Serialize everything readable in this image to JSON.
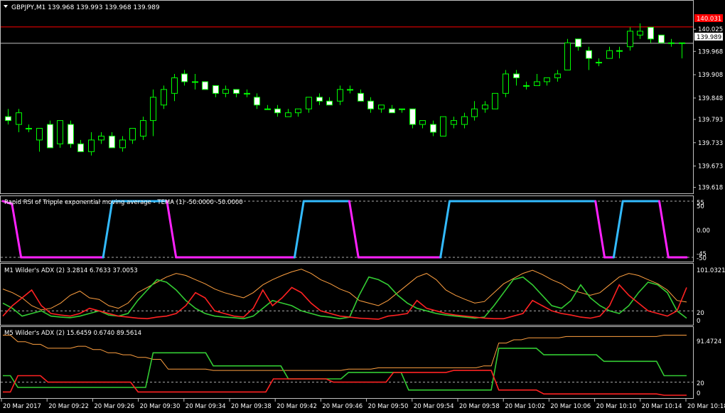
{
  "colors": {
    "background": "#000000",
    "bull_candle": "#00ff00",
    "bear_candle": "#ffffff",
    "tema_up": "#33bbff",
    "tema_down": "#ff22ff",
    "adx_main": "#ffa040",
    "adx_plus": "#33cc33",
    "adx_minus": "#ff2222",
    "price_line_red": "#ff0000",
    "bid_line": "#c0c0c0"
  },
  "main": {
    "symbol_caption": "GBPJPY,M1  139.968 139.993 139.968 139.989",
    "menu_icon": "triangle-down-icon",
    "price_ticks": [
      "140.025",
      "139.968",
      "139.908",
      "139.848",
      "139.793",
      "139.733",
      "139.673",
      "139.618"
    ],
    "red_line_label": "140.031",
    "bid_label": "139.989",
    "ylim": [
      139.61,
      140.06
    ],
    "candles": [
      [
        139.8,
        139.82,
        139.78,
        139.79
      ],
      [
        139.78,
        139.82,
        139.76,
        139.81
      ],
      [
        139.77,
        139.78,
        139.76,
        139.77
      ],
      [
        139.74,
        139.77,
        139.71,
        139.77
      ],
      [
        139.78,
        139.79,
        139.72,
        139.72
      ],
      [
        139.73,
        139.79,
        139.72,
        139.79
      ],
      [
        139.78,
        139.79,
        139.72,
        139.73
      ],
      [
        139.73,
        139.74,
        139.71,
        139.71
      ],
      [
        139.71,
        139.76,
        139.7,
        139.74
      ],
      [
        139.74,
        139.76,
        139.73,
        139.75
      ],
      [
        139.75,
        139.76,
        139.72,
        139.72
      ],
      [
        139.72,
        139.75,
        139.71,
        139.74
      ],
      [
        139.74,
        139.77,
        139.73,
        139.77
      ],
      [
        139.75,
        139.8,
        139.74,
        139.79
      ],
      [
        139.79,
        139.87,
        139.75,
        139.85
      ],
      [
        139.83,
        139.88,
        139.82,
        139.87
      ],
      [
        139.86,
        139.91,
        139.84,
        139.9
      ],
      [
        139.91,
        139.92,
        139.88,
        139.89
      ],
      [
        139.89,
        139.91,
        139.87,
        139.89
      ],
      [
        139.89,
        139.89,
        139.87,
        139.87
      ],
      [
        139.88,
        139.88,
        139.85,
        139.86
      ],
      [
        139.86,
        139.88,
        139.85,
        139.87
      ],
      [
        139.87,
        139.87,
        139.85,
        139.86
      ],
      [
        139.86,
        139.87,
        139.85,
        139.86
      ],
      [
        139.85,
        139.86,
        139.82,
        139.83
      ],
      [
        139.82,
        139.83,
        139.82,
        139.82
      ],
      [
        139.82,
        139.83,
        139.8,
        139.81
      ],
      [
        139.8,
        139.82,
        139.8,
        139.81
      ],
      [
        139.81,
        139.82,
        139.8,
        139.82
      ],
      [
        139.82,
        139.85,
        139.81,
        139.85
      ],
      [
        139.85,
        139.86,
        139.83,
        139.84
      ],
      [
        139.84,
        139.85,
        139.83,
        139.83
      ],
      [
        139.84,
        139.88,
        139.83,
        139.87
      ],
      [
        139.87,
        139.88,
        139.86,
        139.87
      ],
      [
        139.86,
        139.87,
        139.84,
        139.84
      ],
      [
        139.84,
        139.85,
        139.81,
        139.82
      ],
      [
        139.82,
        139.83,
        139.81,
        139.83
      ],
      [
        139.82,
        139.83,
        139.81,
        139.81
      ],
      [
        139.82,
        139.82,
        139.81,
        139.82
      ],
      [
        139.82,
        139.82,
        139.77,
        139.78
      ],
      [
        139.78,
        139.79,
        139.77,
        139.79
      ],
      [
        139.78,
        139.79,
        139.75,
        139.76
      ],
      [
        139.75,
        139.8,
        139.75,
        139.8
      ],
      [
        139.78,
        139.8,
        139.77,
        139.79
      ],
      [
        139.78,
        139.81,
        139.77,
        139.8
      ],
      [
        139.8,
        139.84,
        139.79,
        139.82
      ],
      [
        139.82,
        139.84,
        139.81,
        139.83
      ],
      [
        139.82,
        139.86,
        139.82,
        139.86
      ],
      [
        139.86,
        139.92,
        139.85,
        139.91
      ],
      [
        139.91,
        139.92,
        139.88,
        139.9
      ],
      [
        139.88,
        139.89,
        139.87,
        139.88
      ],
      [
        139.88,
        139.91,
        139.88,
        139.89
      ],
      [
        139.89,
        139.9,
        139.88,
        139.9
      ],
      [
        139.9,
        139.92,
        139.89,
        139.91
      ],
      [
        139.92,
        140.0,
        139.92,
        139.99
      ],
      [
        140.0,
        140.0,
        139.97,
        139.98
      ],
      [
        139.97,
        139.98,
        139.92,
        139.95
      ],
      [
        139.94,
        139.95,
        139.93,
        139.94
      ],
      [
        139.95,
        139.98,
        139.95,
        139.97
      ],
      [
        139.97,
        139.98,
        139.95,
        139.97
      ],
      [
        139.98,
        140.03,
        139.97,
        140.02
      ],
      [
        140.01,
        140.04,
        140.0,
        140.02
      ],
      [
        140.03,
        140.03,
        139.99,
        140.0
      ],
      [
        140.01,
        140.01,
        139.99,
        139.99
      ],
      [
        139.99,
        140.0,
        139.98,
        139.99
      ],
      [
        139.99,
        139.99,
        139.95,
        139.99
      ]
    ]
  },
  "tema": {
    "caption": "Rapid RSI of Tripple exponential moving average - TEMA (1) -50.0000 -50.0000",
    "ticks": [
      "55",
      "50",
      "0.00",
      "-45",
      "-50"
    ],
    "ylim": [
      -55,
      55
    ],
    "levels": [
      50,
      -50
    ],
    "values": [
      50,
      45,
      -50,
      -50,
      -50,
      -50,
      -50,
      -50,
      -50,
      -50,
      -50,
      -50,
      50,
      50,
      50,
      50,
      50,
      50,
      50,
      -50,
      -50,
      -50,
      -50,
      -50,
      -50,
      -50,
      -50,
      -50,
      -50,
      -50,
      -50,
      -50,
      -50,
      50,
      50,
      50,
      50,
      50,
      50,
      -50,
      -50,
      -50,
      -50,
      -50,
      -50,
      -50,
      -50,
      -50,
      -50,
      50,
      50,
      50,
      50,
      50,
      50,
      50,
      50,
      50,
      50,
      50,
      50,
      50,
      50,
      50,
      50,
      50,
      -50,
      -50,
      50,
      50,
      50,
      50,
      50,
      -50,
      -50,
      -50
    ]
  },
  "adx1": {
    "caption": "M1 Wilder's  ADX (2) 3.2814 6.7633 37.0053",
    "ticks": [
      "101.0321",
      "20",
      "0"
    ],
    "ylim": [
      0,
      101
    ],
    "level": 20,
    "adx": [
      62,
      55,
      45,
      30,
      22,
      25,
      35,
      50,
      58,
      45,
      42,
      30,
      25,
      35,
      55,
      65,
      75,
      85,
      92,
      88,
      80,
      72,
      62,
      55,
      50,
      45,
      55,
      70,
      80,
      88,
      95,
      100,
      92,
      80,
      72,
      62,
      55,
      40,
      35,
      30,
      40,
      55,
      70,
      85,
      92,
      80,
      60,
      50,
      42,
      35,
      38,
      55,
      72,
      82,
      92,
      98,
      90,
      80,
      72,
      60,
      55,
      50,
      55,
      70,
      85,
      92,
      88,
      80,
      72,
      60,
      40,
      37
    ],
    "plus_di": [
      35,
      25,
      10,
      15,
      20,
      10,
      8,
      7,
      10,
      15,
      20,
      12,
      10,
      15,
      40,
      60,
      80,
      75,
      60,
      40,
      25,
      15,
      10,
      8,
      7,
      5,
      10,
      25,
      40,
      35,
      30,
      20,
      15,
      10,
      8,
      5,
      8,
      50,
      85,
      80,
      70,
      50,
      35,
      25,
      20,
      15,
      12,
      10,
      8,
      6,
      8,
      30,
      55,
      80,
      85,
      70,
      50,
      30,
      25,
      40,
      70,
      45,
      30,
      20,
      15,
      30,
      55,
      75,
      70,
      55,
      20,
      6
    ],
    "minus_di": [
      10,
      30,
      45,
      60,
      30,
      15,
      12,
      10,
      15,
      25,
      20,
      15,
      10,
      8,
      6,
      5,
      8,
      10,
      15,
      30,
      55,
      45,
      20,
      15,
      10,
      8,
      25,
      60,
      30,
      45,
      65,
      55,
      35,
      20,
      15,
      10,
      8,
      6,
      5,
      4,
      10,
      12,
      15,
      40,
      25,
      20,
      15,
      12,
      10,
      8,
      6,
      5,
      5,
      10,
      15,
      40,
      30,
      20,
      15,
      12,
      8,
      6,
      10,
      30,
      70,
      50,
      35,
      20,
      15,
      10,
      20,
      65
    ]
  },
  "adx5": {
    "caption": "M5 Wilder's  ADX (2) 15.6459 0.6740 89.5614",
    "ticks": [
      "91.4724",
      "20",
      "0"
    ],
    "ylim": [
      0,
      91.5
    ],
    "level": 20,
    "adx": [
      92,
      92,
      82,
      82,
      78,
      78,
      72,
      72,
      72,
      72,
      75,
      75,
      70,
      70,
      65,
      65,
      62,
      62,
      58,
      58,
      55,
      55,
      40,
      40,
      40,
      40,
      40,
      40,
      38,
      38,
      38,
      38,
      38,
      38,
      38,
      38,
      38,
      38,
      38,
      38,
      38,
      38,
      38,
      38,
      38,
      38,
      40,
      40,
      40,
      40,
      42,
      42,
      42,
      42,
      42,
      42,
      42,
      42,
      42,
      42,
      42,
      42,
      42,
      42,
      45,
      45,
      80,
      80,
      85,
      85,
      88,
      88,
      88,
      88,
      88,
      90,
      90,
      90,
      90,
      90,
      90,
      90,
      90,
      90,
      90,
      90,
      90,
      90,
      92,
      92,
      92,
      92
    ],
    "plus_di": [
      30,
      30,
      12,
      12,
      12,
      12,
      12,
      12,
      12,
      12,
      12,
      12,
      12,
      12,
      12,
      12,
      12,
      12,
      12,
      12,
      65,
      65,
      65,
      65,
      65,
      65,
      65,
      65,
      45,
      45,
      45,
      45,
      45,
      45,
      45,
      45,
      45,
      45,
      25,
      25,
      25,
      25,
      25,
      25,
      25,
      25,
      35,
      35,
      35,
      35,
      35,
      35,
      35,
      35,
      8,
      8,
      8,
      8,
      8,
      8,
      8,
      8,
      8,
      8,
      8,
      8,
      72,
      72,
      72,
      72,
      72,
      72,
      62,
      62,
      62,
      62,
      62,
      62,
      62,
      62,
      52,
      52,
      52,
      52,
      52,
      52,
      52,
      52,
      30,
      30,
      30,
      30
    ],
    "minus_di": [
      5,
      5,
      30,
      30,
      30,
      30,
      20,
      20,
      20,
      20,
      20,
      20,
      20,
      20,
      20,
      20,
      20,
      20,
      5,
      5,
      5,
      5,
      5,
      5,
      5,
      5,
      5,
      5,
      5,
      5,
      5,
      5,
      5,
      5,
      5,
      5,
      25,
      25,
      25,
      25,
      25,
      25,
      25,
      25,
      20,
      20,
      20,
      20,
      20,
      20,
      20,
      20,
      35,
      35,
      35,
      35,
      35,
      35,
      35,
      35,
      38,
      38,
      38,
      38,
      38,
      38,
      8,
      8,
      8,
      8,
      8,
      8,
      2,
      2,
      2,
      2,
      2,
      2,
      2,
      2,
      2,
      2,
      2,
      2,
      2,
      2,
      2,
      2,
      0,
      0,
      0,
      0
    ]
  },
  "time_axis": [
    "20 Mar 2017",
    "20 Mar 09:22",
    "20 Mar 09:26",
    "20 Mar 09:30",
    "20 Mar 09:34",
    "20 Mar 09:38",
    "20 Mar 09:42",
    "20 Mar 09:46",
    "20 Mar 09:50",
    "20 Mar 09:54",
    "20 Mar 09:58",
    "20 Mar 10:02",
    "20 Mar 10:06",
    "20 Mar 10:10",
    "20 Mar 10:14",
    "20 Mar 10:18"
  ]
}
